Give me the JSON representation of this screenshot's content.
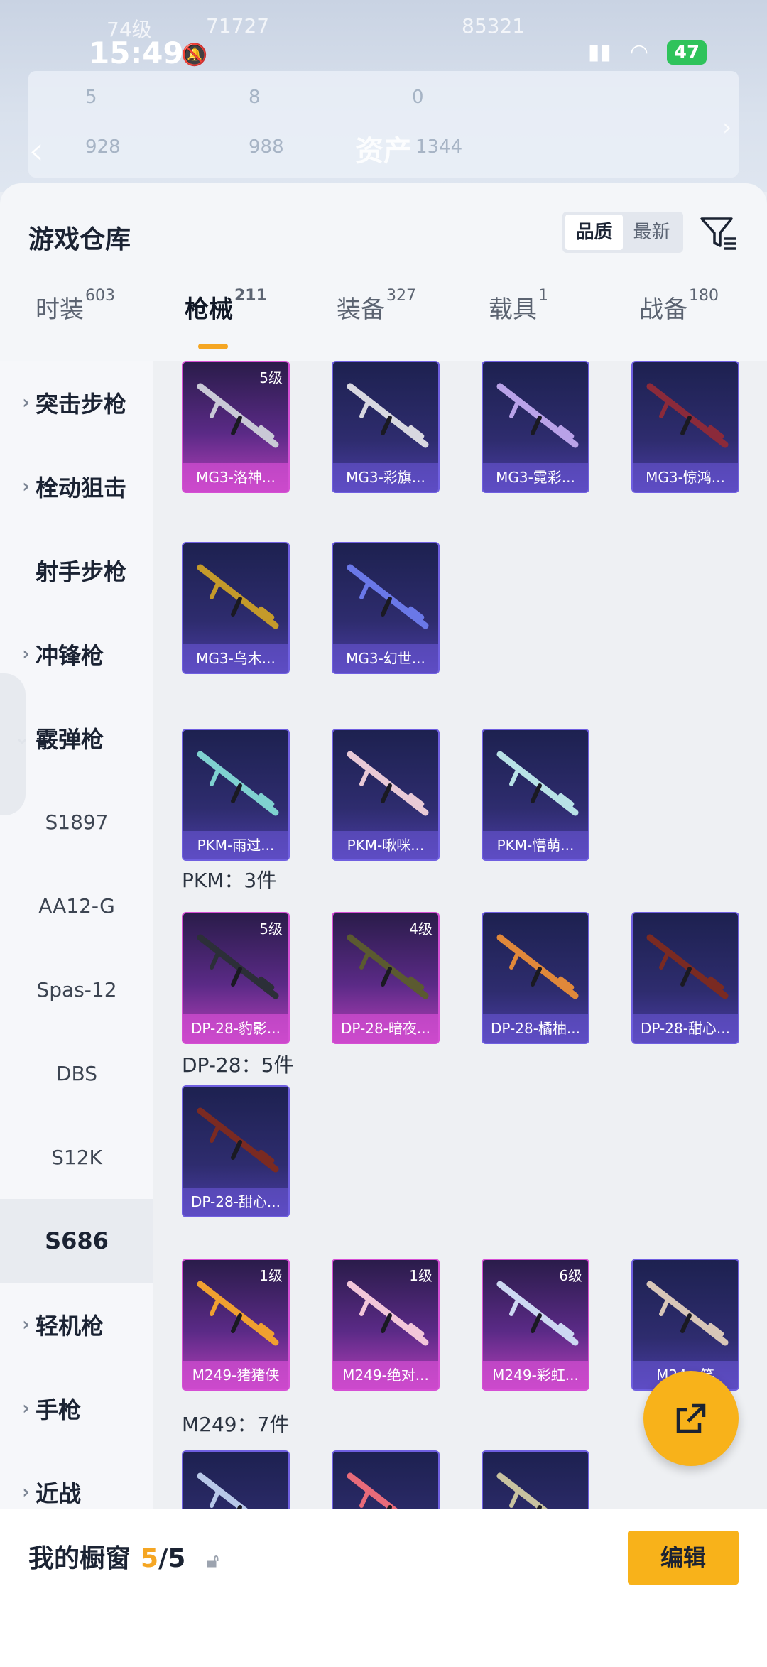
{
  "status": {
    "time": "15:49",
    "battery": "47"
  },
  "header_blur": {
    "row1_a": "74级",
    "row1_b": "71727",
    "row1_c": "85321",
    "row2_a": "5",
    "row2_b": "8",
    "row2_c": "0",
    "row3_a": "928",
    "row3_b": "988",
    "asset_label": "资产",
    "asset_value": "1344"
  },
  "sheet": {
    "title": "游戏仓库",
    "sort": {
      "quality": "品质",
      "newest": "最新"
    }
  },
  "tabs": [
    {
      "label": "时装",
      "count": "603"
    },
    {
      "label": "枪械",
      "count": "211"
    },
    {
      "label": "装备",
      "count": "327"
    },
    {
      "label": "载具",
      "count": "1"
    },
    {
      "label": "战备",
      "count": "180"
    }
  ],
  "sidebar": [
    {
      "label": "突击步枪",
      "kind": "cat",
      "chevron": "›"
    },
    {
      "label": "栓动狙击",
      "kind": "cat",
      "chevron": "›"
    },
    {
      "label": "射手步枪",
      "kind": "cat",
      "chevron": ""
    },
    {
      "label": "冲锋枪",
      "kind": "cat",
      "chevron": "›"
    },
    {
      "label": "霰弹枪",
      "kind": "cat",
      "chevron": "⌄"
    },
    {
      "label": "S1897",
      "kind": "sub"
    },
    {
      "label": "AA12-G",
      "kind": "sub"
    },
    {
      "label": "Spas-12",
      "kind": "sub"
    },
    {
      "label": "DBS",
      "kind": "sub"
    },
    {
      "label": "S12K",
      "kind": "sub"
    },
    {
      "label": "S686",
      "kind": "selected"
    },
    {
      "label": "轻机枪",
      "kind": "cat",
      "chevron": "›"
    },
    {
      "label": "手枪",
      "kind": "cat",
      "chevron": "›"
    },
    {
      "label": "近战",
      "kind": "cat",
      "chevron": "›"
    }
  ],
  "groups": [
    {
      "label": "PKM：3件"
    },
    {
      "label": "DP-28：5件"
    },
    {
      "label": "M249：7件"
    }
  ],
  "cards": [
    {
      "name": "MG3-洛神...",
      "level": "5级",
      "rarity": "purple"
    },
    {
      "name": "MG3-彩旗...",
      "level": "",
      "rarity": "blue"
    },
    {
      "name": "MG3-霓彩...",
      "level": "",
      "rarity": "blue"
    },
    {
      "name": "MG3-惊鸿...",
      "level": "",
      "rarity": "blue"
    },
    {
      "name": "MG3-乌木...",
      "level": "",
      "rarity": "blue"
    },
    {
      "name": "MG3-幻世...",
      "level": "",
      "rarity": "blue"
    },
    {
      "name": "PKM-雨过...",
      "level": "",
      "rarity": "blue"
    },
    {
      "name": "PKM-啾咪...",
      "level": "",
      "rarity": "blue"
    },
    {
      "name": "PKM-懵萌...",
      "level": "",
      "rarity": "blue"
    },
    {
      "name": "DP-28-豹影...",
      "level": "5级",
      "rarity": "purple"
    },
    {
      "name": "DP-28-暗夜...",
      "level": "4级",
      "rarity": "purple"
    },
    {
      "name": "DP-28-橘柚...",
      "level": "",
      "rarity": "blue"
    },
    {
      "name": "DP-28-甜心...",
      "level": "",
      "rarity": "blue"
    },
    {
      "name": "DP-28-甜心...",
      "level": "",
      "rarity": "blue"
    },
    {
      "name": "M249-猪猪侠",
      "level": "1级",
      "rarity": "purple"
    },
    {
      "name": "M249-绝对...",
      "level": "1级",
      "rarity": "purple"
    },
    {
      "name": "M249-彩虹...",
      "level": "6级",
      "rarity": "purple"
    },
    {
      "name": "M24...笑",
      "level": "",
      "rarity": "blue"
    },
    {
      "name": "",
      "level": "",
      "rarity": "blue"
    },
    {
      "name": "",
      "level": "",
      "rarity": "blue"
    },
    {
      "name": "",
      "level": "",
      "rarity": "blue"
    }
  ],
  "bottom": {
    "label": "我的橱窗",
    "count": "5",
    "total": "/5",
    "edit": "编辑"
  },
  "colors": {
    "accent": "#f8b21a",
    "purple": "#d54fd4",
    "blue": "#6f5fe0"
  }
}
